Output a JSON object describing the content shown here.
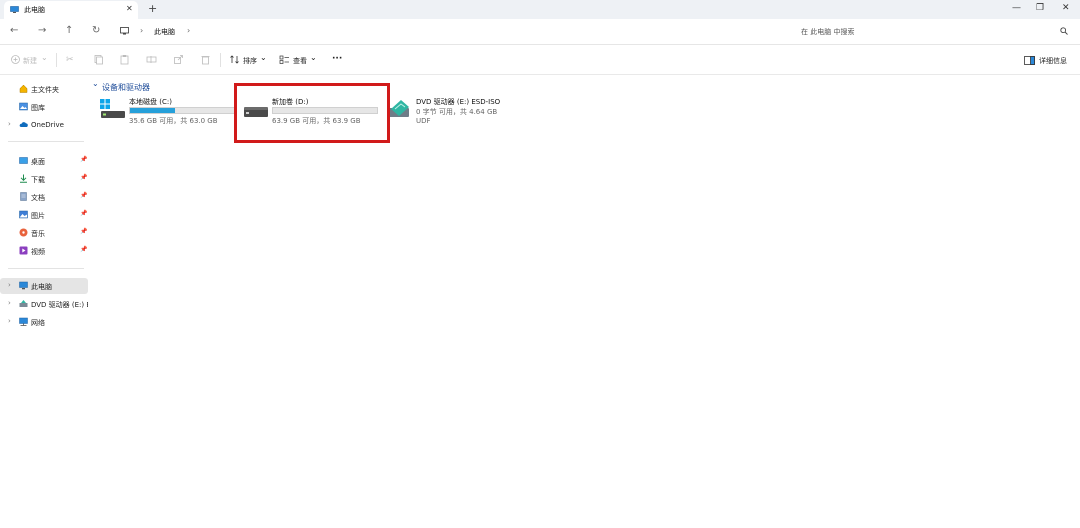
{
  "tab": {
    "title": "此电脑",
    "close": "✕",
    "new_tab": "+"
  },
  "window": {
    "minimize": "—",
    "restore": "❐",
    "close": "✕"
  },
  "nav": {
    "back": "←",
    "forward": "→",
    "up": "↑",
    "refresh": "↻"
  },
  "breadcrumb": {
    "current": "此电脑",
    "sep": "›"
  },
  "search": {
    "placeholder": "在 此电脑 中搜索"
  },
  "toolbar": {
    "new_label": "新建",
    "sort_label": "排序",
    "view_label": "查看",
    "more_label": "···",
    "details_label": "详细信息"
  },
  "sidebar": {
    "items": [
      {
        "label": "主文件夹",
        "icon": "home-icon",
        "chev": ""
      },
      {
        "label": "图库",
        "icon": "gallery-icon",
        "chev": ""
      },
      {
        "label": "OneDrive",
        "icon": "cloud-icon",
        "chev": "›"
      },
      {
        "label": "桌面",
        "icon": "desktop-icon",
        "pinned": true
      },
      {
        "label": "下载",
        "icon": "download-icon",
        "pinned": true
      },
      {
        "label": "文档",
        "icon": "document-icon",
        "pinned": true
      },
      {
        "label": "图片",
        "icon": "picture-icon",
        "pinned": true
      },
      {
        "label": "音乐",
        "icon": "music-icon",
        "pinned": true
      },
      {
        "label": "视频",
        "icon": "video-icon",
        "pinned": true
      },
      {
        "label": "此电脑",
        "icon": "pc-icon",
        "chev": "›",
        "selected": true
      },
      {
        "label": "DVD 驱动器 (E:) ESD-ISO",
        "icon": "dvd-icon",
        "chev": "›"
      },
      {
        "label": "网络",
        "icon": "network-icon",
        "chev": "›"
      }
    ]
  },
  "content": {
    "section_title": "设备和驱动器",
    "section_chev": "⌄",
    "drives": [
      {
        "name": "本地磁盘 (C:)",
        "info": "35.6 GB 可用，共 63.0 GB",
        "used_fraction": 0.43
      },
      {
        "name": "新加卷 (D:)",
        "info": "63.9 GB 可用，共 63.9 GB",
        "used_fraction": 0.0
      },
      {
        "name": "DVD 驱动器 (E:) ESD-ISO",
        "info": "0 字节 可用，共 4.64 GB",
        "fs": "UDF"
      }
    ]
  },
  "colors": {
    "accent": "#26a0da",
    "highlight": "#d11a1a",
    "section": "#1f4d9a"
  }
}
